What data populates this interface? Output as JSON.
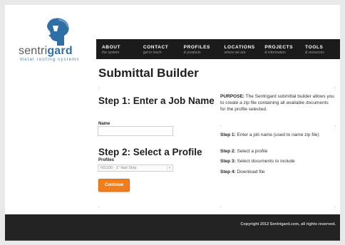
{
  "header": {
    "brand": {
      "part1": "sentri",
      "part2": "gard"
    },
    "tagline": "metal roofing systems"
  },
  "nav": [
    {
      "label": "ABOUT",
      "sub": "the system"
    },
    {
      "label": "CONTACT",
      "sub": "get in touch"
    },
    {
      "label": "PROFILES",
      "sub": "& products"
    },
    {
      "label": "LOCATIONS",
      "sub": "where we are"
    },
    {
      "label": "PROJECTS",
      "sub": "& information"
    },
    {
      "label": "TOOLS",
      "sub": "& resources"
    }
  ],
  "main": {
    "title": "Submittal Builder",
    "step1": {
      "heading": "Step 1: Enter a Job Name",
      "field_label": "Name",
      "value": "",
      "placeholder": ""
    },
    "step2": {
      "heading": "Step 2: Select a Profile",
      "field_label": "Profiles",
      "selected": "NS100 - 1\" Nail Strip"
    },
    "continue_label": "Continue"
  },
  "sidebar": {
    "purpose_label": "PURPOSE:",
    "purpose_text": " The Sentrigard submittal builder allows you to create a zip file containing all available documents for the profile selected.",
    "steps": [
      {
        "label": "Step 1:",
        "text": " Enter a job name (used to name zip file)"
      },
      {
        "label": "Step 2:",
        "text": " Select a profile"
      },
      {
        "label": "Step 3:",
        "text": " Select documents to include"
      },
      {
        "label": "Step 4:",
        "text": " Download file"
      }
    ]
  },
  "footer": {
    "copyright": "Copyright 2012 Sentrigard.com, all rights reserved."
  },
  "colors": {
    "accent": "#f07e1e",
    "nav_bg": "#1b1b1b",
    "brand_blue": "#2f6fa5",
    "footer_bg": "#232323"
  }
}
